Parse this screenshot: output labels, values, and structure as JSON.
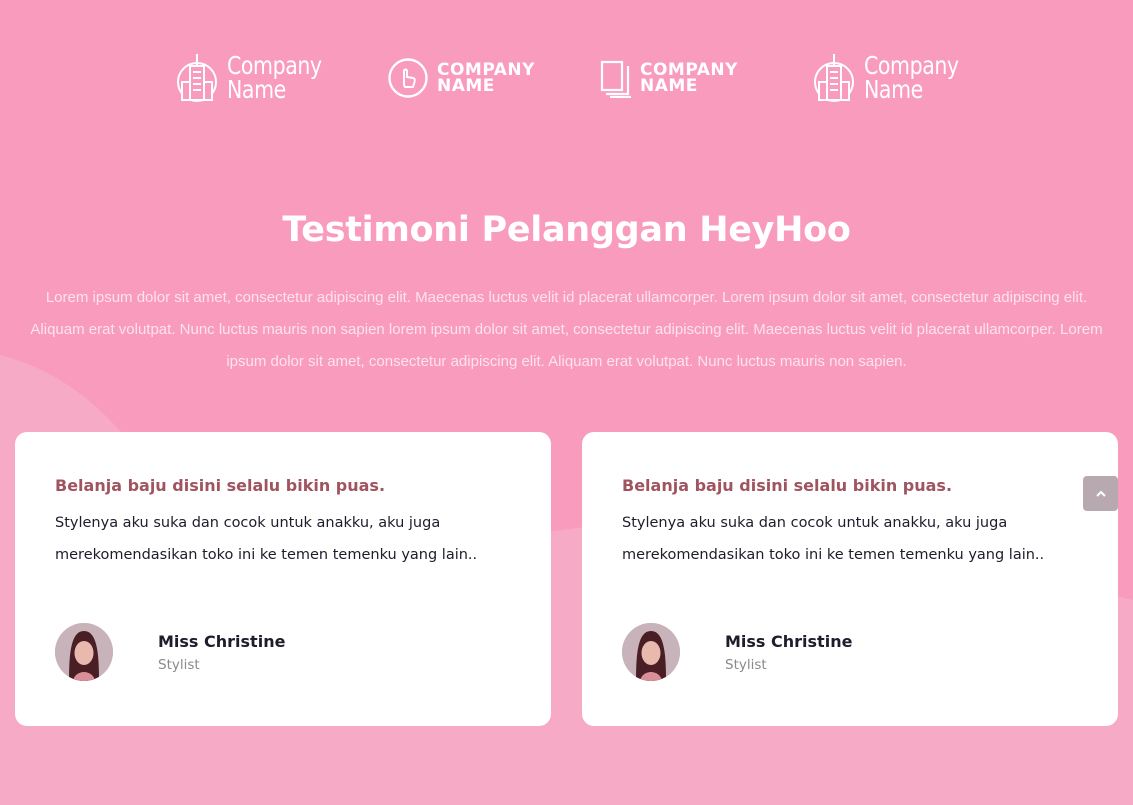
{
  "logos": [
    {
      "icon": "building-icon",
      "line1": "Company",
      "line2": "Name",
      "style": "light"
    },
    {
      "icon": "pointer-hand-icon",
      "line1": "COMPANY",
      "line2": "NAME",
      "style": "bold"
    },
    {
      "icon": "pages-icon",
      "line1": "COMPANY",
      "line2": "NAME",
      "style": "bold"
    },
    {
      "icon": "building-icon",
      "line1": "Company",
      "line2": "Name",
      "style": "light"
    }
  ],
  "section": {
    "title": "Testimoni Pelanggan HeyHoo",
    "description": "Lorem ipsum dolor sit amet, consectetur adipiscing elit. Maecenas luctus velit id placerat ullamcorper. Lorem ipsum dolor sit amet, consectetur adipiscing elit. Aliquam erat volutpat. Nunc luctus mauris non sapien lorem ipsum dolor sit amet, consectetur adipiscing elit. Maecenas luctus velit id placerat ullamcorper. Lorem ipsum dolor sit amet, consectetur adipiscing elit. Aliquam erat volutpat. Nunc luctus mauris non sapien."
  },
  "testimonials": [
    {
      "headline": "Belanja baju disini selalu bikin puas.",
      "body": "Stylenya aku suka dan cocok untuk anakku, aku juga merekomendasikan toko ini ke temen temenku yang lain..",
      "name": "Miss Christine",
      "role": "Stylist"
    },
    {
      "headline": "Belanja baju disini selalu bikin puas.",
      "body": "Stylenya aku suka dan cocok untuk anakku, aku juga merekomendasikan toko ini ke temen temenku yang lain..",
      "name": "Miss Christine",
      "role": "Stylist"
    }
  ],
  "scroll_top": {
    "icon": "chevron-up-icon"
  },
  "colors": {
    "background": "#f99bbd",
    "card": "#ffffff",
    "headline": "#a0545f",
    "text_dark": "#1d1d2b",
    "text_muted": "#8a8a8a"
  }
}
